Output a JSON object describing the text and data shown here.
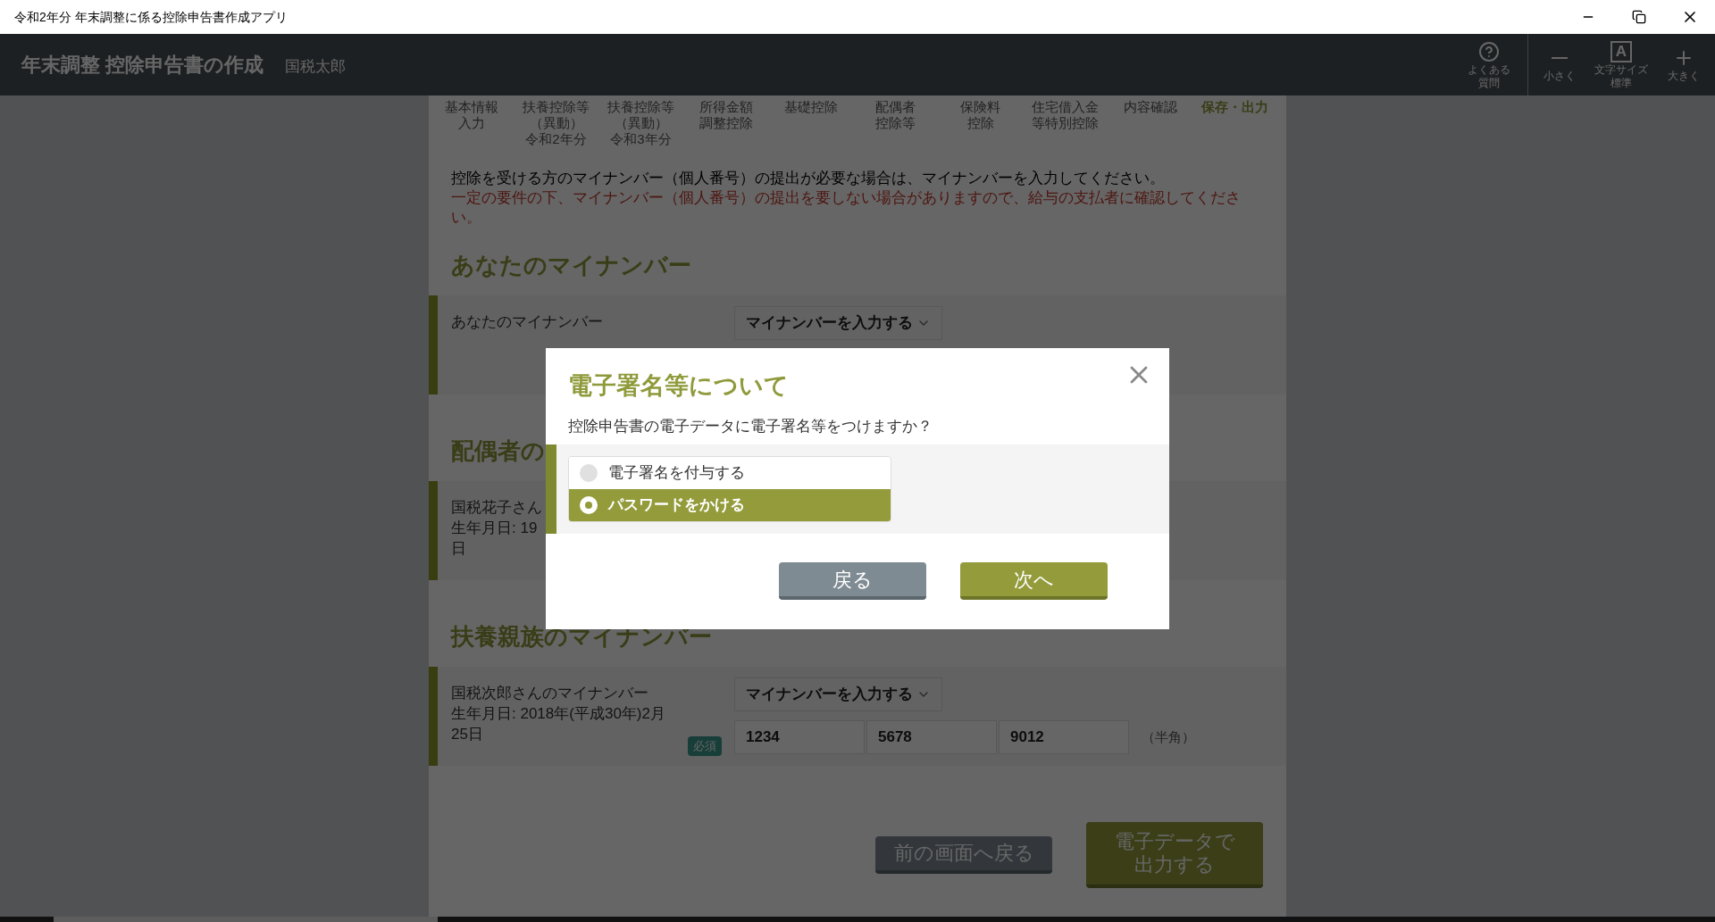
{
  "window": {
    "title": "令和2年分 年末調整に係る控除申告書作成アプリ"
  },
  "header": {
    "title": "年末調整 控除申告書の作成",
    "user": "国税太郎",
    "tools": [
      {
        "kind": "help",
        "lines": [
          "よくある",
          "質問"
        ]
      },
      {
        "kind": "smaller",
        "lines": [
          "小さく"
        ]
      },
      {
        "kind": "fontsize",
        "glyph": "A",
        "lines": [
          "文字サイズ",
          "標準"
        ]
      },
      {
        "kind": "larger",
        "lines": [
          "大きく"
        ]
      }
    ]
  },
  "steps": [
    {
      "lines": [
        "基本情報",
        "入力"
      ],
      "selected": false
    },
    {
      "lines": [
        "扶養控除等",
        "（異動）",
        "令和2年分"
      ],
      "selected": false
    },
    {
      "lines": [
        "扶養控除等",
        "（異動）",
        "令和3年分"
      ],
      "selected": false
    },
    {
      "lines": [
        "所得金額",
        "調整控除"
      ],
      "selected": false
    },
    {
      "lines": [
        "基礎控除"
      ],
      "selected": false
    },
    {
      "lines": [
        "配偶者",
        "控除等"
      ],
      "selected": false
    },
    {
      "lines": [
        "保険料",
        "控除"
      ],
      "selected": false
    },
    {
      "lines": [
        "住宅借入金",
        "等特別控除"
      ],
      "selected": false
    },
    {
      "lines": [
        "内容確認"
      ],
      "selected": false
    },
    {
      "lines": [
        "保存・出力"
      ],
      "selected": true
    }
  ],
  "intro": "控除を受ける方のマイナンバー（個人番号）の提出が必要な場合は、マイナンバーを入力してください。",
  "notice": "一定の要件の下、マイナンバー（個人番号）の提出を要しない場合がありますので、給与の支払者に確認してください。",
  "sections": [
    {
      "heading": "あなたのマイナンバー",
      "row": {
        "label_lines": [
          "あなたのマイナンバー"
        ],
        "select": "マイナンバーを入力する"
      }
    },
    {
      "heading": "配偶者の",
      "row": {
        "label_lines": [
          "国税花子さん",
          "生年月日: 19",
          "日"
        ]
      }
    },
    {
      "heading": "扶養親族のマイナンバー",
      "row": {
        "label_lines": [
          "国税次郎さんのマイナンバー",
          "生年月日: 2018年(平成30年)2月",
          "25日"
        ],
        "required": "必須",
        "select": "マイナンバーを入力する",
        "inputs": [
          "1234",
          "5678",
          "9012"
        ],
        "unit": "（半角）"
      }
    }
  ],
  "footer_buttons": [
    {
      "kind": "secondary",
      "lines": [
        "前の画面へ戻る"
      ]
    },
    {
      "kind": "primary",
      "lines": [
        "電子データで",
        "出力する"
      ]
    }
  ],
  "dialog": {
    "title": "電子署名等について",
    "question": "控除申告書の電子データに電子署名等をつけますか？",
    "options": [
      {
        "label": "電子署名を付与する",
        "selected": false
      },
      {
        "label": "パスワードをかける",
        "selected": true
      }
    ],
    "buttons": [
      {
        "kind": "secondary",
        "label": "戻る"
      },
      {
        "kind": "primary",
        "label": "次へ"
      }
    ]
  }
}
